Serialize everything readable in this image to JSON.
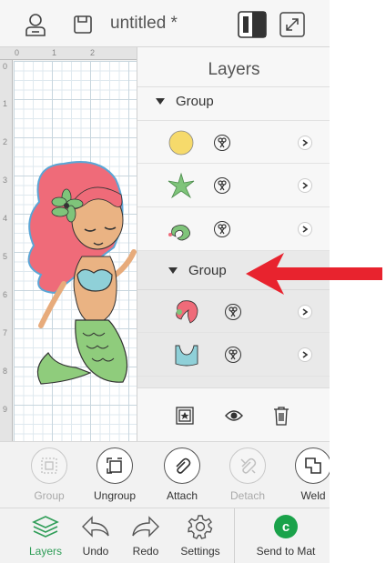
{
  "topbar": {
    "title": "untitled *"
  },
  "ruler": {
    "top_numbers": [
      "0",
      "1",
      "2"
    ],
    "left_numbers": [
      "0",
      "1",
      "2",
      "3",
      "4",
      "5",
      "6",
      "7",
      "8",
      "9"
    ]
  },
  "layers": {
    "header": "Layers",
    "group1_label": "Group",
    "group1_items": [
      {
        "icon": "yellow-circle",
        "color": "#f6da6b"
      },
      {
        "icon": "green-starfish",
        "color": "#7fc47a"
      },
      {
        "icon": "seahorse",
        "color": "#7fc47a"
      }
    ],
    "group2_label": "Group",
    "group2_items": [
      {
        "icon": "mermaid-hair",
        "color": "#ef6b79"
      },
      {
        "icon": "mermaid-top",
        "color": "#8fd0d8"
      }
    ]
  },
  "panel_tools": [
    "add-layer-icon",
    "visibility-icon",
    "delete-icon"
  ],
  "actions": [
    {
      "label": "Group",
      "enabled": false
    },
    {
      "label": "Ungroup",
      "enabled": true
    },
    {
      "label": "Attach",
      "enabled": true
    },
    {
      "label": "Detach",
      "enabled": false
    },
    {
      "label": "Weld",
      "enabled": true
    }
  ],
  "nav": [
    {
      "label": "Layers",
      "active": true
    },
    {
      "label": "Undo",
      "active": false
    },
    {
      "label": "Redo",
      "active": false
    },
    {
      "label": "Settings",
      "active": false
    },
    {
      "label": "Send to Mat",
      "active": false
    }
  ],
  "send_badge": "c",
  "colors": {
    "accent": "#2f9d57",
    "arrow": "#e8232e",
    "hair": "#ef6b79",
    "tail": "#8fcc7c"
  }
}
